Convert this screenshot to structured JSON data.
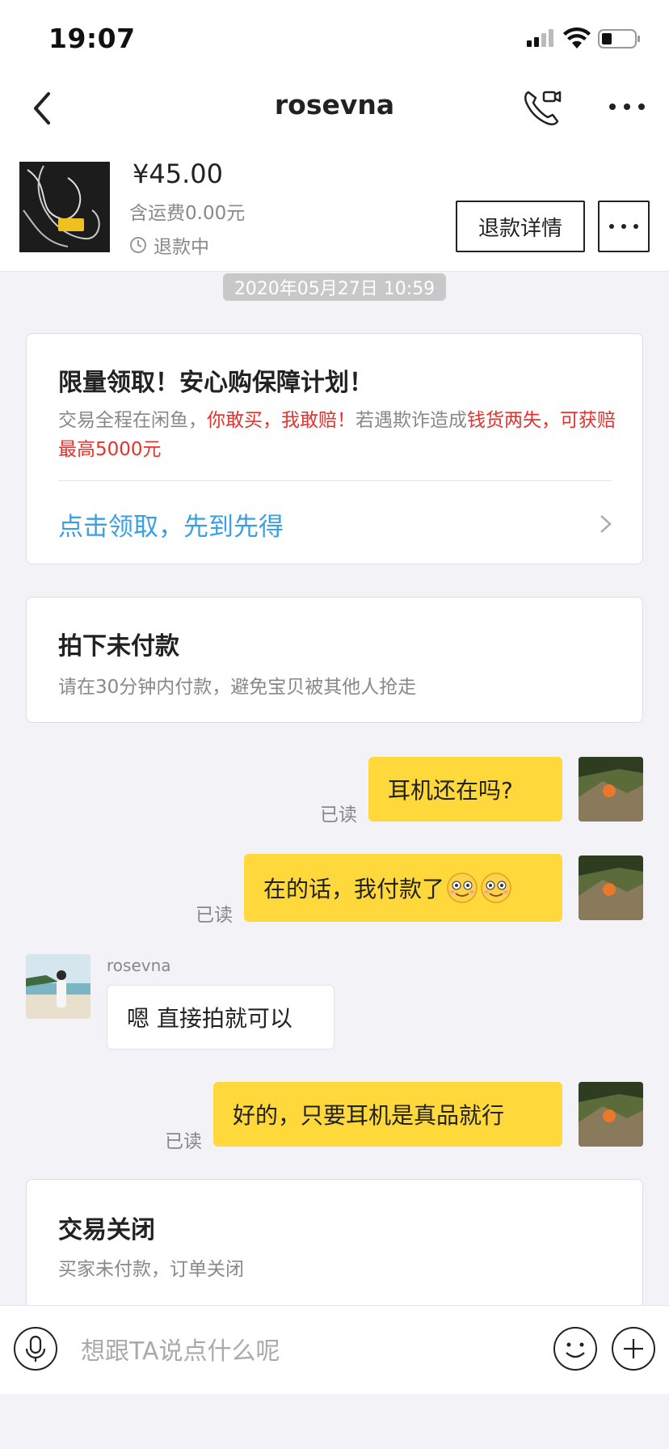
{
  "status_bar": {
    "time": "19:07"
  },
  "nav": {
    "title": "rosevna"
  },
  "product": {
    "price": "¥45.00",
    "shipping": "含运费0.00元",
    "status": "退款中",
    "refund_button": "退款详情"
  },
  "chat_timestamp": "2020年05月27日 10:59",
  "promo": {
    "title": "限量领取！安心购保障计划！",
    "text_1": "交易全程在闲鱼，",
    "text_2": "你敢买，我敢赔！",
    "text_3": "若遇欺诈造成",
    "text_4": "钱货两失，可获赔最高5000元",
    "link": "点击领取，先到先得"
  },
  "unpaid_card": {
    "title": "拍下未付款",
    "subtitle": "请在30分钟内付款，避免宝贝被其他人抢走"
  },
  "messages": [
    {
      "from": "me",
      "text": "耳机还在吗?",
      "read": "已读"
    },
    {
      "from": "me",
      "text": "在的话，我付款了",
      "emoji": [
        "grin-icon",
        "grin-icon"
      ],
      "read": "已读"
    },
    {
      "from": "other",
      "name": "rosevna",
      "text": "嗯 直接拍就可以"
    },
    {
      "from": "me",
      "text": "好的，只要耳机是真品就行",
      "read": "已读"
    }
  ],
  "closed_card": {
    "title": "交易关闭",
    "subtitle": "买家未付款，订单关闭"
  },
  "input": {
    "placeholder": "想跟TA说点什么呢"
  },
  "colors": {
    "accent_yellow": "#ffd83b",
    "link_blue": "#3aa0e6",
    "alert_red": "#e5322d"
  }
}
